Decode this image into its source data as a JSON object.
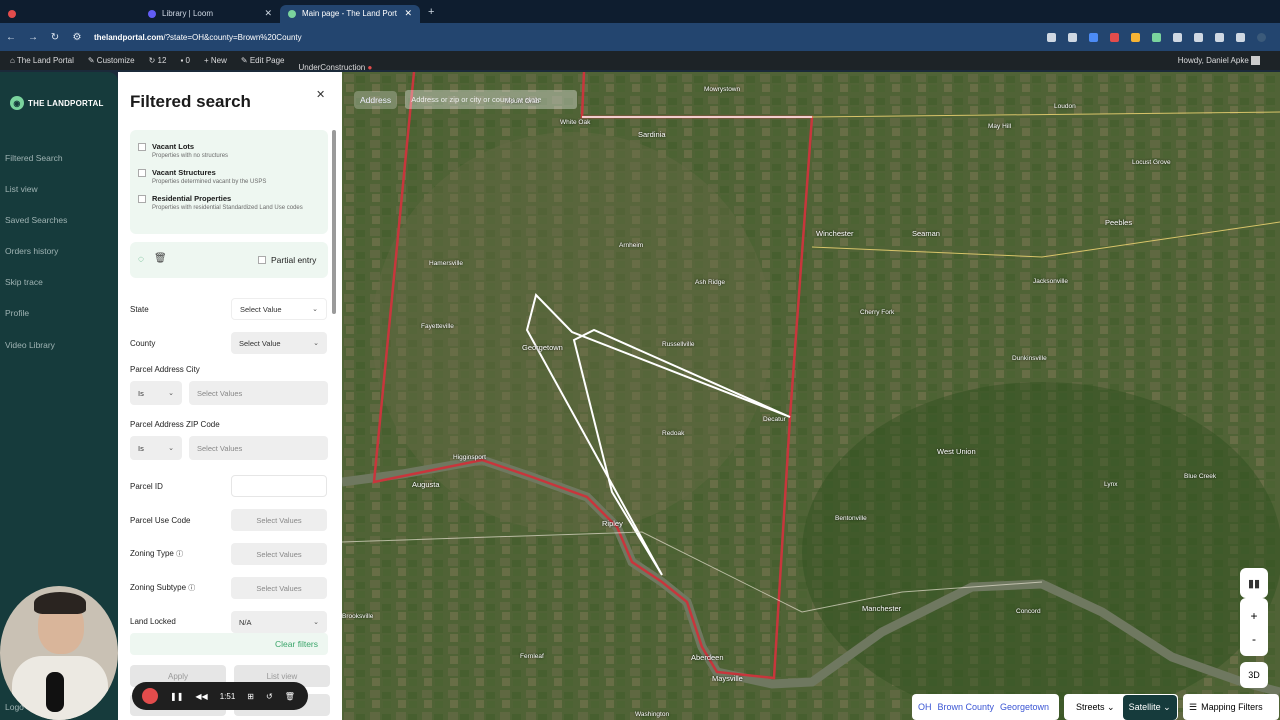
{
  "browser": {
    "tabs": [
      {
        "label": ""
      },
      {
        "label": "Library | Loom"
      },
      {
        "label": "Main page - The Land Port"
      }
    ],
    "url_prefix": "thelandportal.com",
    "url_rest": "/?state=OH&county=Brown%20County"
  },
  "wp_admin": {
    "site": "The Land Portal",
    "customize": "Customize",
    "updates": "12",
    "comments": "0",
    "new": "New",
    "edit": "Edit Page",
    "construction": "UnderConstruction",
    "howdy": "Howdy, Daniel Apke"
  },
  "sidebar": {
    "logo": "THE LANDPORTAL",
    "items": [
      {
        "label": "Filtered Search"
      },
      {
        "label": "List view"
      },
      {
        "label": "Saved Searches"
      },
      {
        "label": "Orders history"
      },
      {
        "label": "Skip trace"
      },
      {
        "label": "Profile"
      },
      {
        "label": "Video Library"
      },
      {
        "label": "Logo"
      }
    ]
  },
  "panel": {
    "title": "Filtered search",
    "checkboxes": [
      {
        "title": "Vacant Lots",
        "sub": "Properties with no structures"
      },
      {
        "title": "Vacant Structures",
        "sub": "Properties determined vacant by the USPS"
      },
      {
        "title": "Residential Properties",
        "sub": "Properties with residential Standardized Land Use codes"
      }
    ],
    "partial_entry": "Partial entry",
    "fields": {
      "state_label": "State",
      "state_value": "Select Value",
      "county_label": "County",
      "county_value": "Select Value",
      "city_label": "Parcel Address City",
      "city_op": "Is",
      "city_value": "Select Values",
      "zip_label": "Parcel Address ZIP Code",
      "zip_op": "Is",
      "zip_value": "Select Values",
      "parcel_id_label": "Parcel ID",
      "use_code_label": "Parcel Use Code",
      "use_code_value": "Select Values",
      "zoning_type_label": "Zoning Type",
      "zoning_type_value": "Select Values",
      "zoning_subtype_label": "Zoning Subtype",
      "zoning_subtype_value": "Select Values",
      "land_locked_label": "Land Locked",
      "land_locked_value": "N/A"
    },
    "clear_filters": "Clear filters",
    "apply": "Apply",
    "list_view": "List view"
  },
  "map": {
    "address_label": "Address",
    "address_placeholder": "Address or zip or city or county or state",
    "towns": [
      "Mowrystown",
      "Sardinia",
      "White Oak",
      "Mount Orab",
      "Loudon",
      "May Hill",
      "Locust Grove",
      "Winchester",
      "Seaman",
      "Peebles",
      "Arnheim",
      "Hamersville",
      "Ash Ridge",
      "Jacksonville",
      "Cherry Fork",
      "Fayetteville",
      "Georgetown",
      "Russellville",
      "Dunkinsville",
      "Decatur",
      "Higginsport",
      "Augusta",
      "West Union",
      "Redoak",
      "Lynx",
      "Blue Creek",
      "Bentonville",
      "Ripley",
      "Manchester",
      "Concord",
      "Brooksville",
      "Fernleaf",
      "Aberdeen",
      "Maysville",
      "Washington"
    ],
    "breadcrumb": {
      "state": "OH",
      "county": "Brown County",
      "city": "Georgetown"
    },
    "streets": "Streets",
    "satellite": "Satellite",
    "mapping_filters": "Mapping Filters",
    "zoom_in": "+",
    "zoom_out": "-",
    "three_d": "3D"
  },
  "recorder": {
    "time": "1:51"
  }
}
